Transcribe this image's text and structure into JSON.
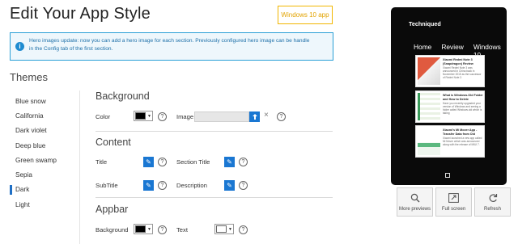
{
  "header": {
    "title": "Edit Your App Style",
    "badge_label": "Windows 10 app"
  },
  "info_banner": {
    "icon": "info-icon",
    "line1": "Hero images update: now you can add a hero image for each section. Previously configured hero image can be handle",
    "line2": "in the Config tab of the first section."
  },
  "themes": {
    "heading": "Themes",
    "items": [
      "Blue snow",
      "California",
      "Dark violet",
      "Deep blue",
      "Green swamp",
      "Sepia",
      "Dark",
      "Light"
    ],
    "selected": "Dark"
  },
  "background_section": {
    "heading": "Background",
    "color_label": "Color",
    "color_value": "#000000",
    "image_label": "Image",
    "image_value": "",
    "clear_glyph": "×"
  },
  "content_section": {
    "heading": "Content",
    "title_label": "Title",
    "section_title_label": "Section Title",
    "subtitle_label": "SubTitle",
    "description_label": "Description"
  },
  "appbar_section": {
    "heading": "Appbar",
    "background_label": "Background",
    "background_color": "#000000",
    "text_label": "Text",
    "text_color": "#ffffff"
  },
  "help_glyph": "?",
  "preview": {
    "brand": "Techniqued",
    "nav": [
      "Home",
      "Review",
      "Windows 10"
    ],
    "cards": [
      {
        "title": "Xiaomi Redmi Note 3 (Snapdragon) Review",
        "text": "Xiaomi Redmi Note 3 was announced in China back in November 2015 as the successor of Redmi Note 2."
      },
      {
        "title": "What is Windows.Old Folder and How to Delete",
        "text": "Have you recently upgraded your version of Windows and seeing a folder called Windows.old which is taking"
      },
      {
        "title": "Xiaomi's Mi Mover App - Transfer Data from Old",
        "text": "Xiaomi launched a new app called Mi Mover which was announced along with the release of MIUI 7."
      }
    ]
  },
  "preview_buttons": {
    "more": "More previews",
    "full": "Full screen",
    "refresh": "Refresh"
  },
  "colors": {
    "accent": "#1a77d2",
    "badge": "#f2b600",
    "info_border": "#2a9fd6",
    "phone_bg": "#0a0a0a"
  }
}
